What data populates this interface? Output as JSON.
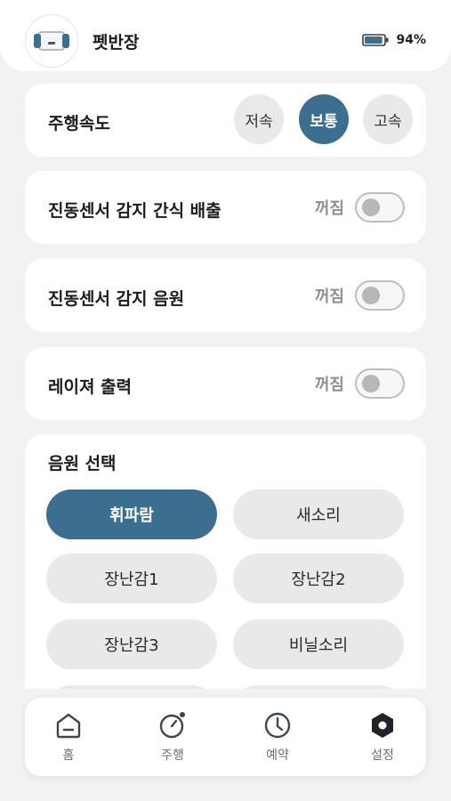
{
  "header": {
    "device_name": "펫반장",
    "battery_text": "94%",
    "battery_level": 0.94
  },
  "speed": {
    "label": "주행속도",
    "options": [
      "저속",
      "보통",
      "고속"
    ],
    "selected": "보통"
  },
  "toggles": [
    {
      "label": "진동센서 감지 간식 배출",
      "state": "꺼짐"
    },
    {
      "label": "진동센서 감지 음원",
      "state": "꺼짐"
    },
    {
      "label": "레이져 출력",
      "state": "꺼짐"
    }
  ],
  "sound": {
    "title": "음원 선택",
    "options": [
      "휘파람",
      "새소리",
      "장난감1",
      "장난감2",
      "장난감3",
      "비닐소리"
    ],
    "selected": "휘파람"
  },
  "nav": {
    "items": [
      {
        "label": "홈",
        "icon": "home-icon"
      },
      {
        "label": "주행",
        "icon": "drive-gauge-icon"
      },
      {
        "label": "예약",
        "icon": "clock-icon"
      },
      {
        "label": "설정",
        "icon": "settings-hexagon-icon"
      }
    ]
  },
  "colors": {
    "accent": "#3c6e8f",
    "background": "#f2f2f4",
    "card": "#ffffff",
    "chip": "#e9e9ec"
  }
}
